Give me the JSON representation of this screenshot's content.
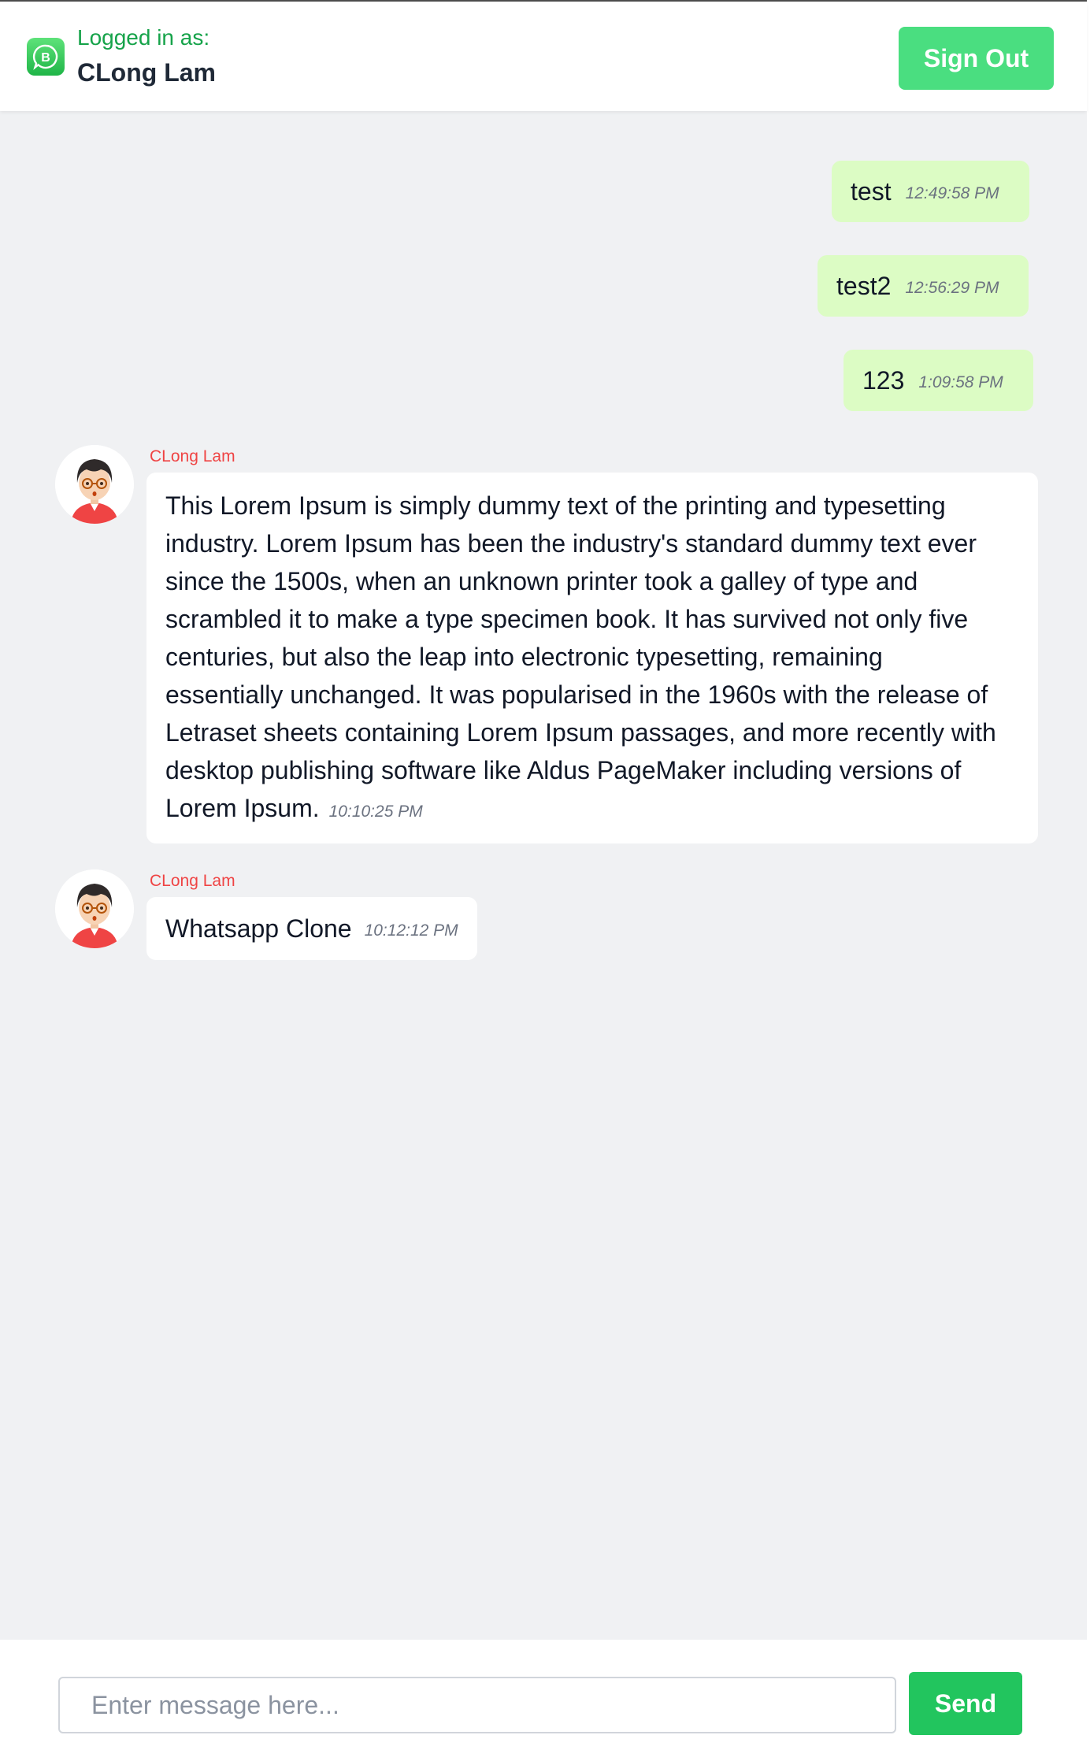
{
  "header": {
    "logo_icon": "whatsapp-business-icon",
    "logged_in_label": "Logged in as:",
    "user_name": "CLong Lam",
    "sign_out_label": "Sign Out"
  },
  "colors": {
    "accent_green": "#22c55e",
    "outgoing_bubble": "#dcfcc4",
    "chat_background": "#f0f1f3",
    "sender_name": "#ef4444"
  },
  "outgoing_messages": [
    {
      "text": "test",
      "time": "12:49:58 PM"
    },
    {
      "text": "test2",
      "time": "12:56:29 PM"
    },
    {
      "text": "123",
      "time": "1:09:58 PM"
    }
  ],
  "incoming_messages": [
    {
      "sender": "CLong Lam",
      "avatar_icon": "user-avatar-icon",
      "lines": [
        "This Lorem Ipsum is simply dummy text of the printing and typesetting",
        "industry. Lorem Ipsum has been the industry's standard dummy text ever",
        "since the 1500s, when an unknown printer took a galley of type and",
        "scrambled it to make a type specimen book. It has survived not only five",
        "centuries, but also the leap into electronic typesetting, remaining",
        "essentially unchanged. It was popularised in the 1960s with the release of",
        "Letraset sheets containing Lorem Ipsum passages, and more recently with",
        "desktop publishing software like Aldus PageMaker including versions of",
        "Lorem Ipsum."
      ],
      "time": "10:10:25 PM"
    },
    {
      "sender": "CLong Lam",
      "avatar_icon": "user-avatar-icon",
      "text": "Whatsapp Clone",
      "time": "10:12:12 PM"
    }
  ],
  "composer": {
    "placeholder": "Enter message here...",
    "value": "",
    "send_label": "Send"
  }
}
